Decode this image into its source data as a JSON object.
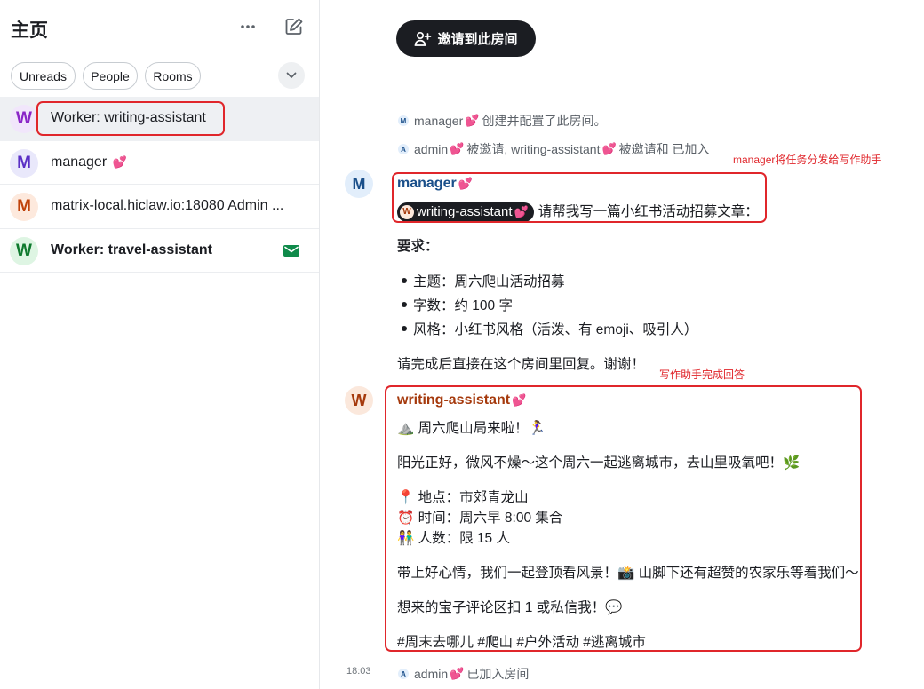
{
  "sidebar": {
    "title": "主页",
    "filters": [
      "Unreads",
      "People",
      "Rooms"
    ],
    "rooms": [
      {
        "initial": "W",
        "name": "Worker: writing-assistant"
      },
      {
        "initial": "M",
        "name": "manager",
        "suffix": "💕"
      },
      {
        "initial": "M",
        "name": "matrix-local.hiclaw.io:18080 Admin ..."
      },
      {
        "initial": "W",
        "name": "Worker: travel-assistant"
      }
    ]
  },
  "timeline": {
    "invite_label": "邀请到此房间",
    "events": [
      {
        "avatar": "M",
        "actor": "manager",
        "text": "创建并配置了此房间。"
      },
      {
        "avatar": "A",
        "actor": "admin",
        "text": "被邀请, writing-assistant",
        "text2": "被邀请和 已加入"
      }
    ],
    "annotation_1": "manager将任务分发给写作助手",
    "annotation_2": "写作助手完成回答",
    "manager_message": {
      "avatar": "M",
      "sender": "manager",
      "mention": "writing-assistant",
      "mention_avatar": "W",
      "first_line": "请帮我写一篇小红书活动招募文章：",
      "req_heading": "要求：",
      "bullets": [
        "主题：周六爬山活动招募",
        "字数：约 100 字",
        "风格：小红书风格（活泼、有 emoji、吸引人）"
      ],
      "closing": "请完成后直接在这个房间里回复。谢谢！"
    },
    "assistant_message": {
      "avatar": "W",
      "sender": "writing-assistant",
      "lines": [
        "⛰️ 周六爬山局来啦！🏃‍♀️",
        "阳光正好，微风不燥～这个周六一起逃离城市，去山里吸氧吧！🌿",
        "📍 地点：市郊青龙山",
        "⏰ 时间：周六早 8:00 集合",
        "👫 人数：限 15 人",
        "带上好心情，我们一起登顶看风景！📸 山脚下还有超赞的农家乐等着我们～",
        "想来的宝子评论区扣 1 或私信我！💬",
        "#周末去哪儿 #爬山 #户外活动 #逃离城市"
      ]
    },
    "last_event": {
      "time": "18:03",
      "avatar": "A",
      "actor": "admin",
      "text": "已加入房间"
    }
  }
}
